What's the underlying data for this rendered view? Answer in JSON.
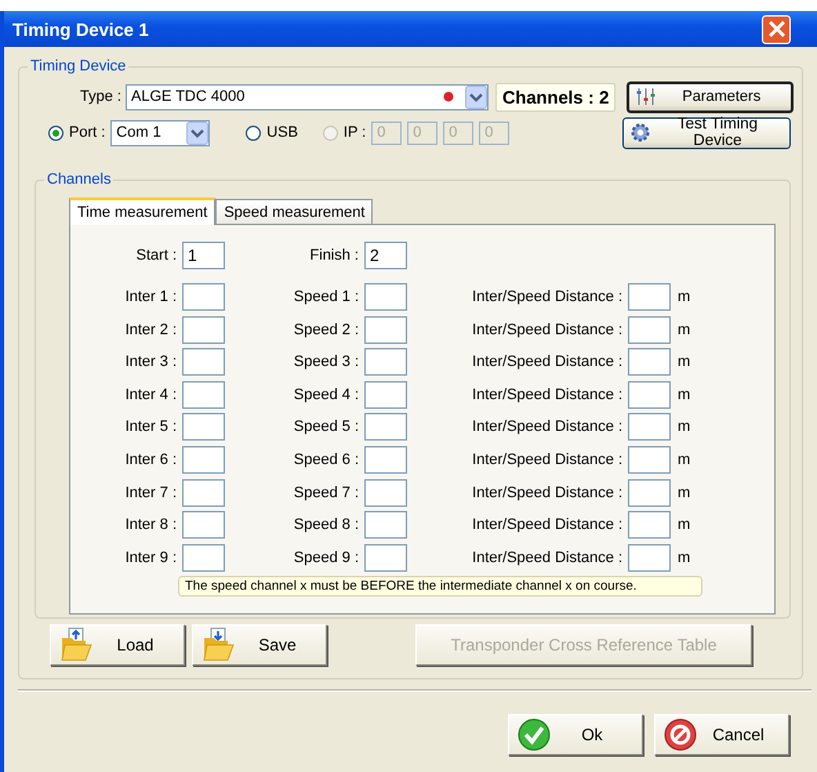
{
  "window": {
    "title": "Timing Device 1"
  },
  "timing_device": {
    "title": "Timing Device",
    "type_label": "Type :",
    "type_value": "ALGE TDC 4000",
    "channels": "Channels : 2",
    "parameters_button": "Parameters",
    "test_button": "Test Timing Device",
    "connections": [
      {
        "kind": "port",
        "label": "Port :",
        "selected": true,
        "value": "Com 1"
      },
      {
        "kind": "usb",
        "label": "USB",
        "selected": false
      },
      {
        "kind": "ip",
        "label": "IP :",
        "selected": false,
        "disabled": true,
        "fields": [
          "0",
          "0",
          "0",
          "0"
        ]
      }
    ]
  },
  "channels": {
    "title": "Channels",
    "tabs": [
      {
        "label": "Time measurement",
        "selected": true
      },
      {
        "label": "Speed measurement",
        "selected": false
      }
    ],
    "start_label": "Start :",
    "start_value": "1",
    "finish_label": "Finish :",
    "finish_value": "2",
    "rows": [
      {
        "inter": "Inter 1 :",
        "speed": "Speed 1 :",
        "distance": "Inter/Speed Distance :",
        "unit": "m"
      },
      {
        "inter": "Inter 2 :",
        "speed": "Speed 2 :",
        "distance": "Inter/Speed Distance :",
        "unit": "m"
      },
      {
        "inter": "Inter 3 :",
        "speed": "Speed 3 :",
        "distance": "Inter/Speed Distance :",
        "unit": "m"
      },
      {
        "inter": "Inter 4 :",
        "speed": "Speed 4 :",
        "distance": "Inter/Speed Distance :",
        "unit": "m"
      },
      {
        "inter": "Inter 5 :",
        "speed": "Speed 5 :",
        "distance": "Inter/Speed Distance :",
        "unit": "m"
      },
      {
        "inter": "Inter 6 :",
        "speed": "Speed 6 :",
        "distance": "Inter/Speed Distance :",
        "unit": "m"
      },
      {
        "inter": "Inter 7 :",
        "speed": "Speed 7 :",
        "distance": "Inter/Speed Distance :",
        "unit": "m"
      },
      {
        "inter": "Inter 8 :",
        "speed": "Speed 8 :",
        "distance": "Inter/Speed Distance :",
        "unit": "m"
      },
      {
        "inter": "Inter 9 :",
        "speed": "Speed 9 :",
        "distance": "Inter/Speed Distance :",
        "unit": "m"
      }
    ],
    "note": "The speed channel x must be BEFORE the intermediate channel x on course."
  },
  "file_buttons": [
    {
      "kind": "load",
      "label": "Load",
      "disabled": false
    },
    {
      "kind": "save",
      "label": "Save",
      "disabled": false
    },
    {
      "kind": "plain",
      "label": "Transponder Cross Reference Table",
      "disabled": true
    }
  ],
  "dialog_buttons": [
    {
      "kind": "ok",
      "label": "Ok"
    },
    {
      "kind": "cancel",
      "label": "Cancel"
    }
  ]
}
